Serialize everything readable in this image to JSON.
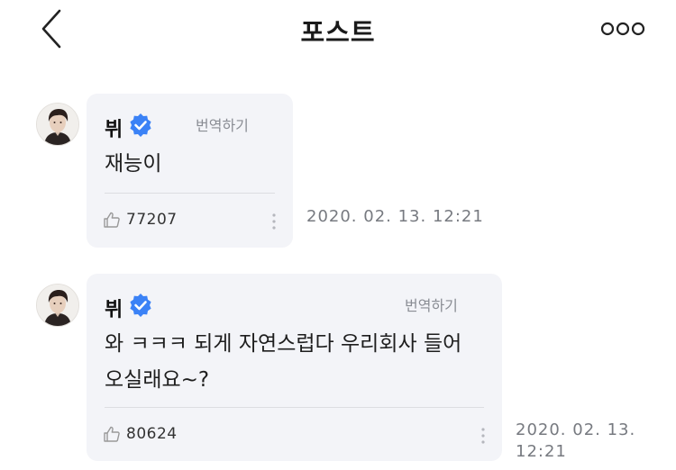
{
  "header": {
    "title": "포스트",
    "back_icon": "chevron-left-icon",
    "more_icon": "more-options-icon"
  },
  "posts": [
    {
      "author": "뷔",
      "verified_icon": "verified-badge-icon",
      "translate_label": "번역하기",
      "text": "재능이",
      "likes": "77207",
      "timestamp": "2020. 02. 13.\n12:21"
    },
    {
      "author": "뷔",
      "verified_icon": "verified-badge-icon",
      "translate_label": "번역하기",
      "text": "와 ㅋㅋㅋ 되게 자연스럽다 우리회사 들어\n오실래요~?",
      "likes": "80624",
      "timestamp": "2020. 02. 13.\n12:21"
    }
  ],
  "colors": {
    "verified": "#3b82f6",
    "bubble": "#f3f4f8"
  }
}
